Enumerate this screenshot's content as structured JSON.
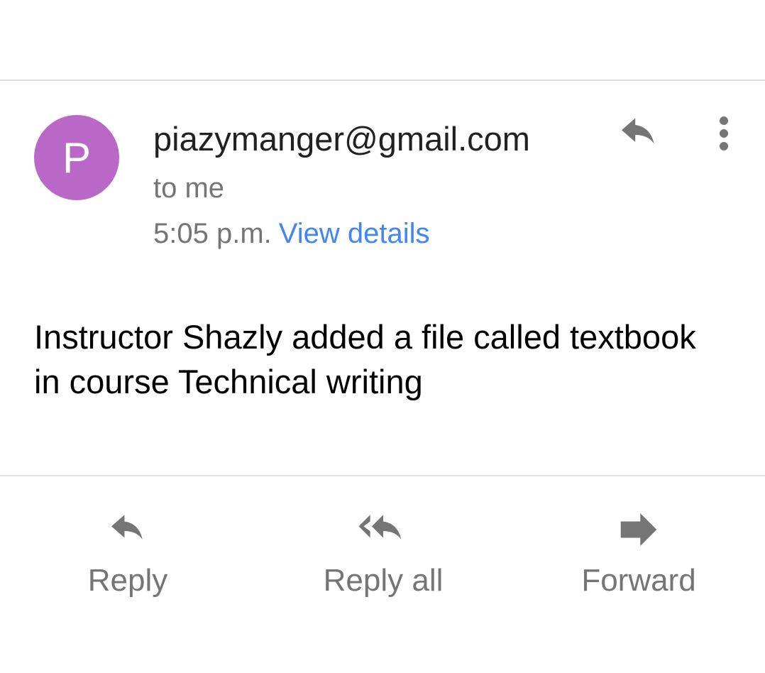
{
  "email": {
    "avatar_letter": "P",
    "avatar_color": "#ba68c8",
    "sender": "piazymanger@gmail.com",
    "recipient": "to me",
    "time": "5:05 p.m.",
    "view_details_label": "View details",
    "link_color": "#4285f4",
    "body": "Instructor Shazly added a file called textbook in course Technical writing"
  },
  "header_actions": {
    "reply_icon": "reply-icon",
    "menu_icon": "more-vert-icon"
  },
  "actions": {
    "reply_label": "Reply",
    "reply_all_label": "Reply all",
    "forward_label": "Forward"
  }
}
